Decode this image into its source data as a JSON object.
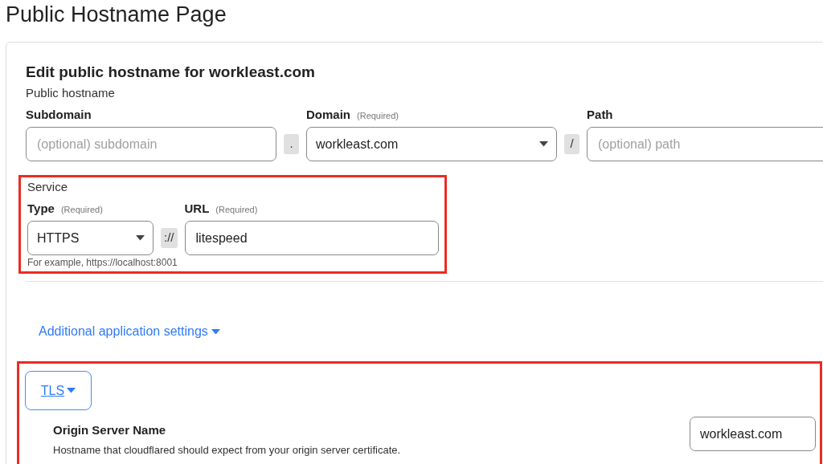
{
  "page_title": "Public Hostname Page",
  "form": {
    "heading": "Edit public hostname for workleast.com",
    "section_label": "Public hostname",
    "hostname_fields": [
      {
        "kind": "input",
        "label": "Subdomain",
        "placeholder": "(optional) subdomain"
      },
      {
        "kind": "separator",
        "text": "."
      },
      {
        "kind": "select",
        "label": "Domain",
        "required_note": "(Required)",
        "value": "workleast.com"
      },
      {
        "kind": "separator",
        "text": "/"
      },
      {
        "kind": "input",
        "label": "Path",
        "placeholder": "(optional) path"
      }
    ],
    "service": {
      "label": "Service",
      "highlighted": true,
      "fields": [
        {
          "kind": "select",
          "label": "Type",
          "required_note": "(Required)",
          "value": "HTTPS"
        },
        {
          "kind": "separator",
          "text": "://"
        },
        {
          "kind": "input",
          "label": "URL",
          "required_note": "(Required)",
          "value": "litespeed"
        }
      ],
      "hint": "For example, https://localhost:8001"
    },
    "additional_settings": {
      "label": "Additional application settings"
    },
    "tls": {
      "highlighted": true,
      "tab": "TLS",
      "origin_server_name": {
        "title": "Origin Server Name",
        "description": "Hostname that cloudflared should expect from your origin server certificate.",
        "value": "workleast.com"
      }
    }
  }
}
